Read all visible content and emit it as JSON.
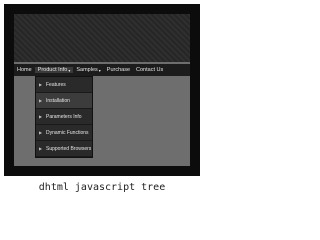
{
  "menubar": {
    "items": [
      {
        "label": "Home",
        "has_arrow": false
      },
      {
        "label": "Product Info",
        "has_arrow": true
      },
      {
        "label": "Samples",
        "has_arrow": true
      },
      {
        "label": "Purchase",
        "has_arrow": false
      },
      {
        "label": "Contact Us",
        "has_arrow": false
      }
    ]
  },
  "dropdown": {
    "items": [
      {
        "label": "Features"
      },
      {
        "label": "Installation"
      },
      {
        "label": "Parameters Info"
      },
      {
        "label": "Dynamic Functions"
      },
      {
        "label": "Supported Browsers"
      }
    ]
  },
  "caption": "dhtml javascript tree",
  "colors": {
    "frame": "#0c0c0c",
    "panel": "#6e6e6e",
    "menubar": "#1c1c1c"
  }
}
